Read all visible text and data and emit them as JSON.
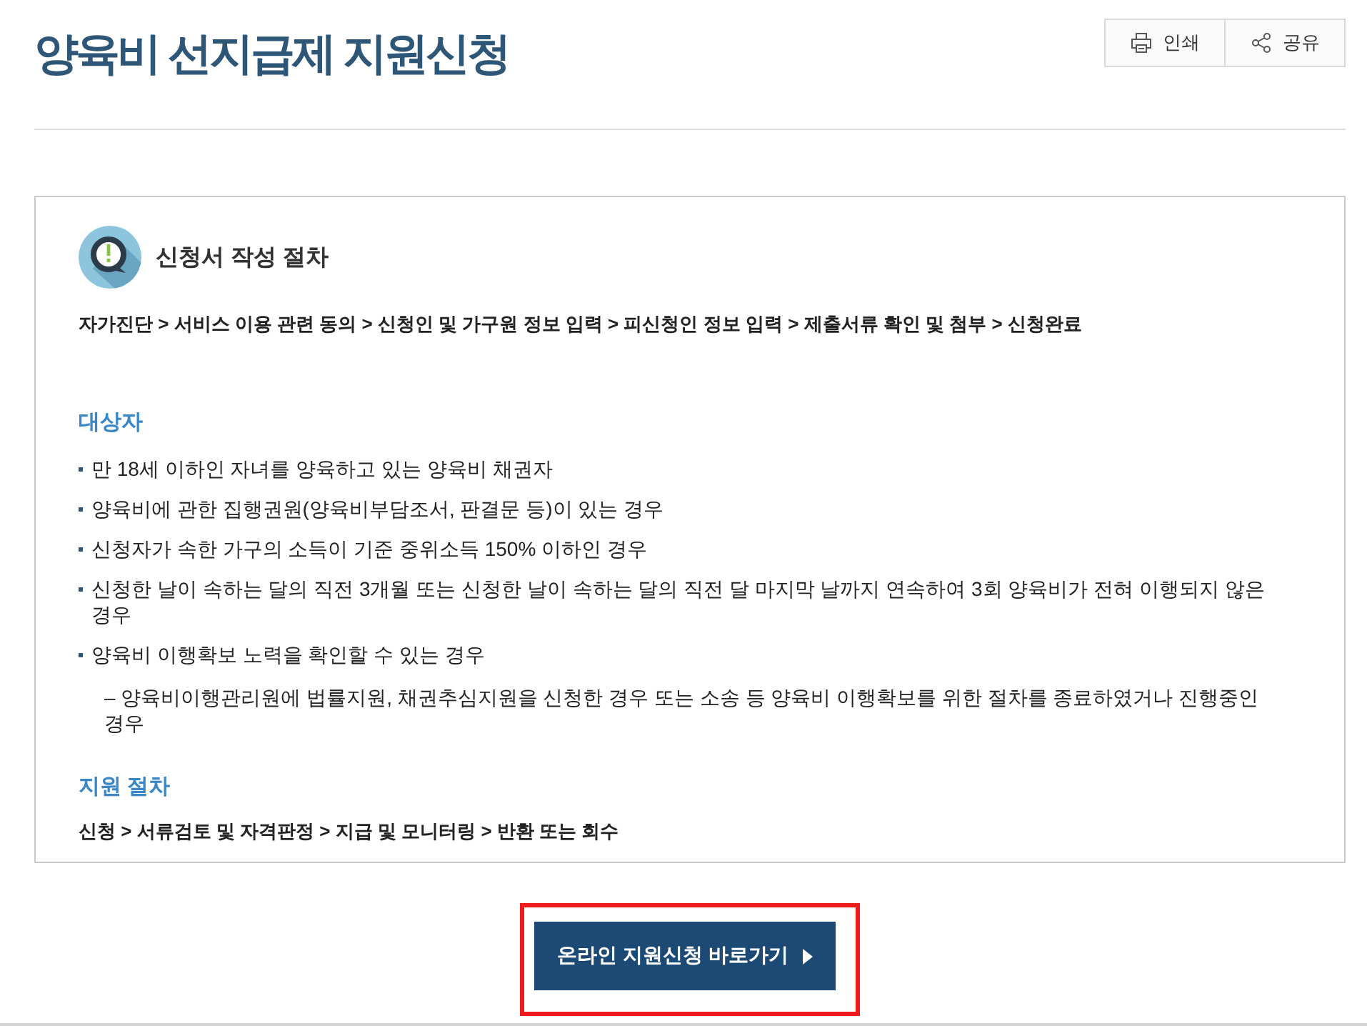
{
  "page": {
    "title": "양육비 선지급제 지원신청"
  },
  "toolbar": [
    {
      "kind": "print",
      "label": "인쇄"
    },
    {
      "kind": "share",
      "label": "공유"
    }
  ],
  "procedure_box": {
    "heading": "신청서 작성 절차",
    "steps": "자가진단 > 서비스 이용 관련 동의 > 신청인 및 가구원 정보 입력 > 피신청인 정보 입력 > 제출서류 확인 및 첨부 > 신청완료"
  },
  "sections": [
    {
      "kind": "list",
      "title": "대상자",
      "items": [
        {
          "text": "만 18세 이하인 자녀를 양육하고 있는 양육비 채권자"
        },
        {
          "text": "양육비에 관한 집행권원(양육비부담조서, 판결문 등)이 있는 경우"
        },
        {
          "text": "신청자가 속한 가구의 소득이 기준 중위소득 150% 이하인 경우"
        },
        {
          "text": "신청한 날이 속하는 달의 직전 3개월 또는 신청한 날이 속하는 달의 직전 달 마지막 날까지 연속하여 3회 양육비가 전혀 이행되지 않은 경우"
        },
        {
          "text": "양육비 이행확보 노력을 확인할 수 있는 경우",
          "children": [
            {
              "text": "– 양육비이행관리원에 법률지원, 채권추심지원을 신청한 경우 또는 소송 등 양육비 이행확보를 위한 절차를 종료하였거나 진행중인 경우"
            }
          ]
        }
      ]
    },
    {
      "kind": "steps",
      "title": "지원 절차",
      "text": "신청 > 서류검토 및 자격판정 > 지급 및 모니터링 > 반환 또는 회수"
    }
  ],
  "cta_button": {
    "label": "온라인 지원신청 바로가기",
    "highlighted": true
  }
}
